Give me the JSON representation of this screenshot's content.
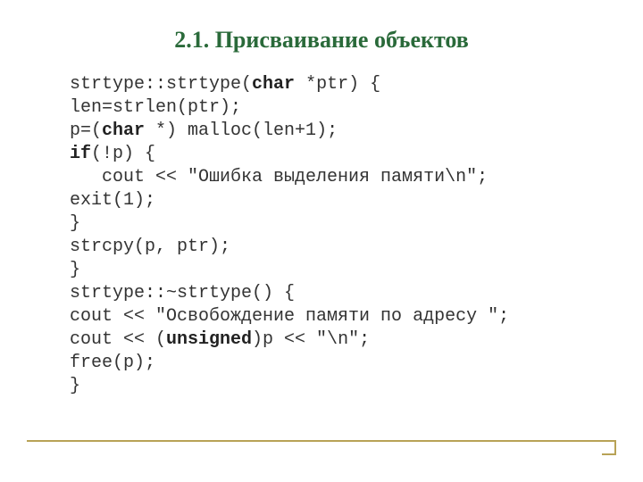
{
  "title": "2.1. Присваивание объектов",
  "code": {
    "l1a": "strtype::strtype(",
    "l1b": "char",
    "l1c": " *ptr) {",
    "l2": "len=strlen(ptr);",
    "l3a": "p=(",
    "l3b": "char",
    "l3c": " *) malloc(len+1);",
    "l4a": "if",
    "l4b": "(!p) {",
    "l5": "   cout << \"Ошибка выделения памяти\\n\";",
    "l6": "exit(1);",
    "l7": "}",
    "l8": "strcpy(p, ptr);",
    "l9": "}",
    "l10": "strtype::~strtype() {",
    "l11": "cout << \"Освобождение памяти по адресу \";",
    "l12a": "cout << (",
    "l12b": "unsigned",
    "l12c": ")p << \"\\n\";",
    "l13": "free(p);",
    "l14": "}"
  }
}
